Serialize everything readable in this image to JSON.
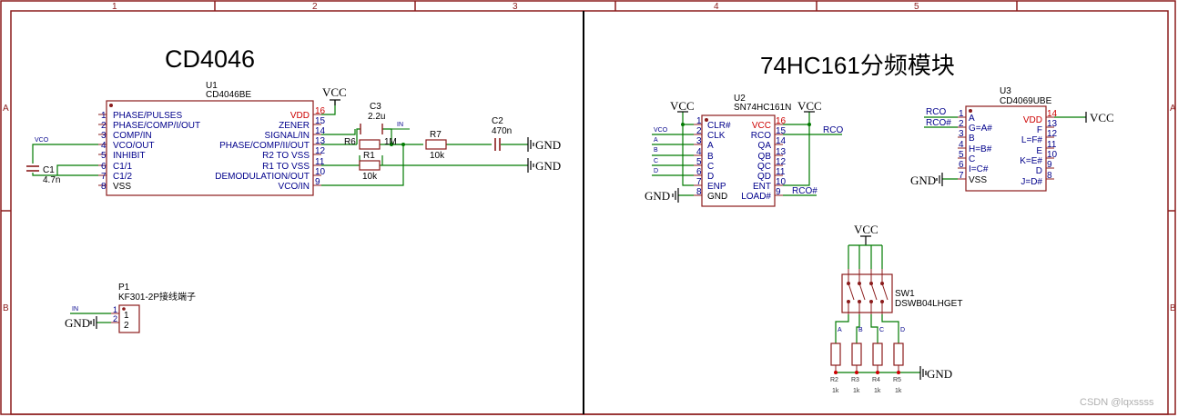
{
  "frame": {
    "col_labels": [
      "1",
      "2",
      "3",
      "4",
      "5"
    ],
    "row_labels": [
      "A",
      "B"
    ]
  },
  "titles": {
    "left": "CD4046",
    "right": "74HC161分频模块"
  },
  "watermark": "CSDN @lqxssss",
  "u1": {
    "ref": "U1",
    "part": "CD4046BE",
    "left_pin_nums": [
      "1",
      "2",
      "3",
      "4",
      "5",
      "6",
      "7",
      "8"
    ],
    "left_pin_names": [
      "PHASE/PULSES",
      "PHASE/COMP/I/OUT",
      "COMP/IN",
      "VCO/OUT",
      "INHIBIT",
      "C1/1",
      "C1/2",
      "VSS"
    ],
    "right_pin_nums": [
      "16",
      "15",
      "14",
      "13",
      "12",
      "11",
      "10",
      "9"
    ],
    "right_pin_names": [
      "VDD",
      "ZENER",
      "SIGNAL/IN",
      "PHASE/COMP/II/OUT",
      "R2 TO VSS",
      "R1 TO VSS",
      "DEMODULATION/OUT",
      "VCO/IN"
    ]
  },
  "u1_parts": {
    "vcc": "VCC",
    "c3_ref": "C3",
    "c3_val": "2.2u",
    "in_label": "IN",
    "r6_ref": "R6",
    "r6_val": "1M",
    "r7_ref": "R7",
    "r7_val": "10k",
    "c2_ref": "C2",
    "c2_val": "470n",
    "r1_ref": "R1",
    "r1_val": "10k",
    "gnd1": "GND",
    "gnd2": "GND",
    "vco_label": "VCO",
    "c1_ref": "C1",
    "c1_val": "4.7n"
  },
  "u2": {
    "ref": "U2",
    "part": "SN74HC161N",
    "left_pin_nums": [
      "1",
      "2",
      "3",
      "4",
      "5",
      "6",
      "7",
      "8"
    ],
    "left_pin_names": [
      "CLR#",
      "CLK",
      "A",
      "B",
      "C",
      "D",
      "ENP",
      "GND"
    ],
    "right_pin_nums": [
      "16",
      "15",
      "14",
      "13",
      "12",
      "11",
      "10",
      "9"
    ],
    "right_pin_names": [
      "VCC",
      "RCO",
      "QA",
      "QB",
      "QC",
      "QD",
      "ENT",
      "LOAD#"
    ],
    "vcc_left": "VCC",
    "vcc_right": "VCC",
    "vco_net": "VCO",
    "net_letters": [
      "A",
      "B",
      "C",
      "D"
    ],
    "rco_net": "RCO",
    "rco_hash_net": "RCO#",
    "gnd": "GND"
  },
  "u3": {
    "ref": "U3",
    "part": "CD4069UBE",
    "left_pin_nums": [
      "1",
      "2",
      "3",
      "4",
      "5",
      "6",
      "7"
    ],
    "left_pin_names": [
      "A",
      "G=A#",
      "B",
      "H=B#",
      "C",
      "I=C#",
      "VSS"
    ],
    "right_pin_nums": [
      "14",
      "13",
      "12",
      "11",
      "10",
      "9",
      "8"
    ],
    "right_pin_names": [
      "VDD",
      "F",
      "L=F#",
      "E",
      "K=E#",
      "D",
      "J=D#"
    ],
    "net_rco": "RCO",
    "net_rco_hash": "RCO#",
    "vcc": "VCC",
    "gnd": "GND"
  },
  "p1": {
    "ref": "P1",
    "part": "KF301-2P接线端子",
    "pin_nums": [
      "1",
      "2"
    ],
    "in_label": "IN",
    "gnd": "GND"
  },
  "sw1": {
    "ref": "SW1",
    "part": "DSWB04LHGET",
    "vcc": "VCC",
    "net_letters": [
      "A",
      "B",
      "C",
      "D"
    ],
    "resistor_refs": [
      "R2",
      "R3",
      "R4",
      "R5"
    ],
    "resistor_vals": [
      "1k",
      "1k",
      "1k",
      "1k"
    ],
    "gnd": "GND"
  },
  "colors": {
    "frame": "#8b1c1c",
    "wire": "#007a00",
    "component": "#8b1c1c",
    "pin_label": "#00008b",
    "pin_num": "#00008b",
    "power_pin": "#cc0000",
    "net_label": "#00008b"
  }
}
